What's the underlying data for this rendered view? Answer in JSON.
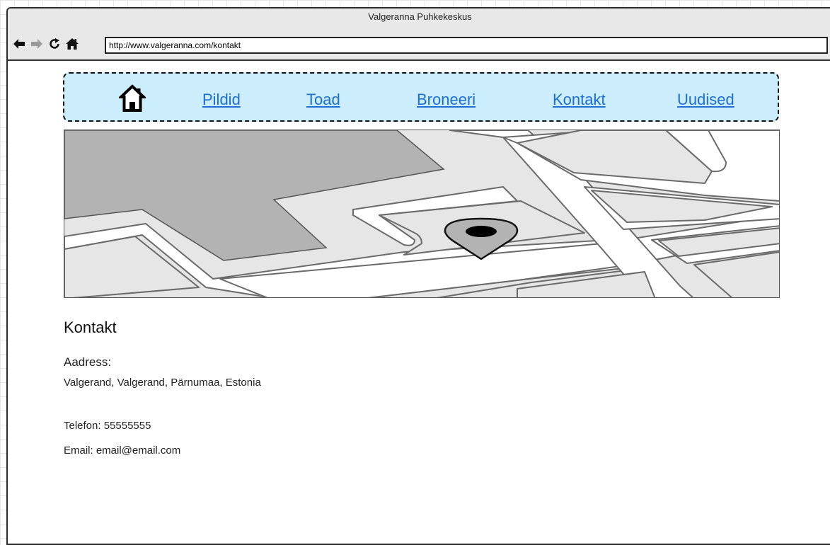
{
  "browser": {
    "window_title": "Valgeranna Puhkekeskus",
    "url": "http://www.valgeranna.com/kontakt",
    "back_icon": "arrow-left-icon",
    "forward_icon": "arrow-right-icon",
    "reload_icon": "reload-icon",
    "home_icon": "home-icon"
  },
  "nav": {
    "home_icon": "house-icon",
    "links": [
      {
        "label": "Pildid"
      },
      {
        "label": "Toad"
      },
      {
        "label": "Broneeri"
      },
      {
        "label": "Kontakt"
      },
      {
        "label": "Uudised"
      }
    ],
    "background_color": "#cceefc",
    "link_color": "#1f6fd1"
  },
  "map": {
    "marker_icon": "map-pin-icon"
  },
  "contact": {
    "heading": "Kontakt",
    "address_label": "Aadress:",
    "address": "Valgerand, Valgerand, Pärnumaa, Estonia",
    "phone": "Telefon: 55555555",
    "email": "Email: email@email.com"
  }
}
